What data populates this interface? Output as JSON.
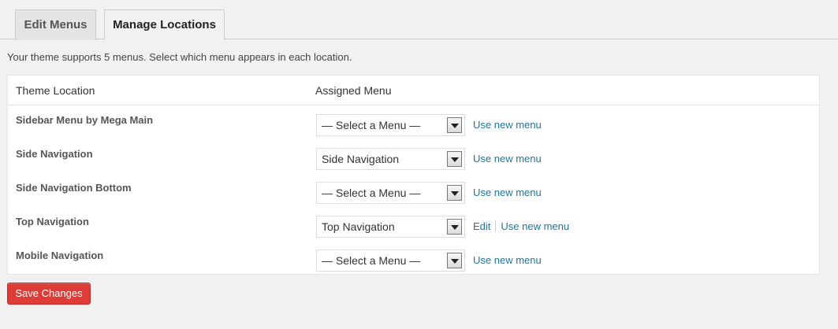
{
  "tabs": [
    {
      "label": "Edit Menus",
      "active": false
    },
    {
      "label": "Manage Locations",
      "active": true
    }
  ],
  "intro": "Your theme supports 5 menus. Select which menu appears in each location.",
  "table": {
    "headers": {
      "location": "Theme Location",
      "menu": "Assigned Menu"
    },
    "rows": [
      {
        "location": "Sidebar Menu by Mega Main",
        "selected": "— Select a Menu —",
        "edit": "",
        "use_new": "Use new menu"
      },
      {
        "location": "Side Navigation",
        "selected": "Side Navigation",
        "edit": "",
        "use_new": "Use new menu"
      },
      {
        "location": "Side Navigation Bottom",
        "selected": "— Select a Menu —",
        "edit": "",
        "use_new": "Use new menu"
      },
      {
        "location": "Top Navigation",
        "selected": "Top Navigation",
        "edit": "Edit",
        "use_new": "Use new menu"
      },
      {
        "location": "Mobile Navigation",
        "selected": "— Select a Menu —",
        "edit": "",
        "use_new": "Use new menu"
      }
    ]
  },
  "save_button": "Save Changes",
  "colors": {
    "accent_link": "#21759b",
    "save_button": "#dd3d36"
  }
}
